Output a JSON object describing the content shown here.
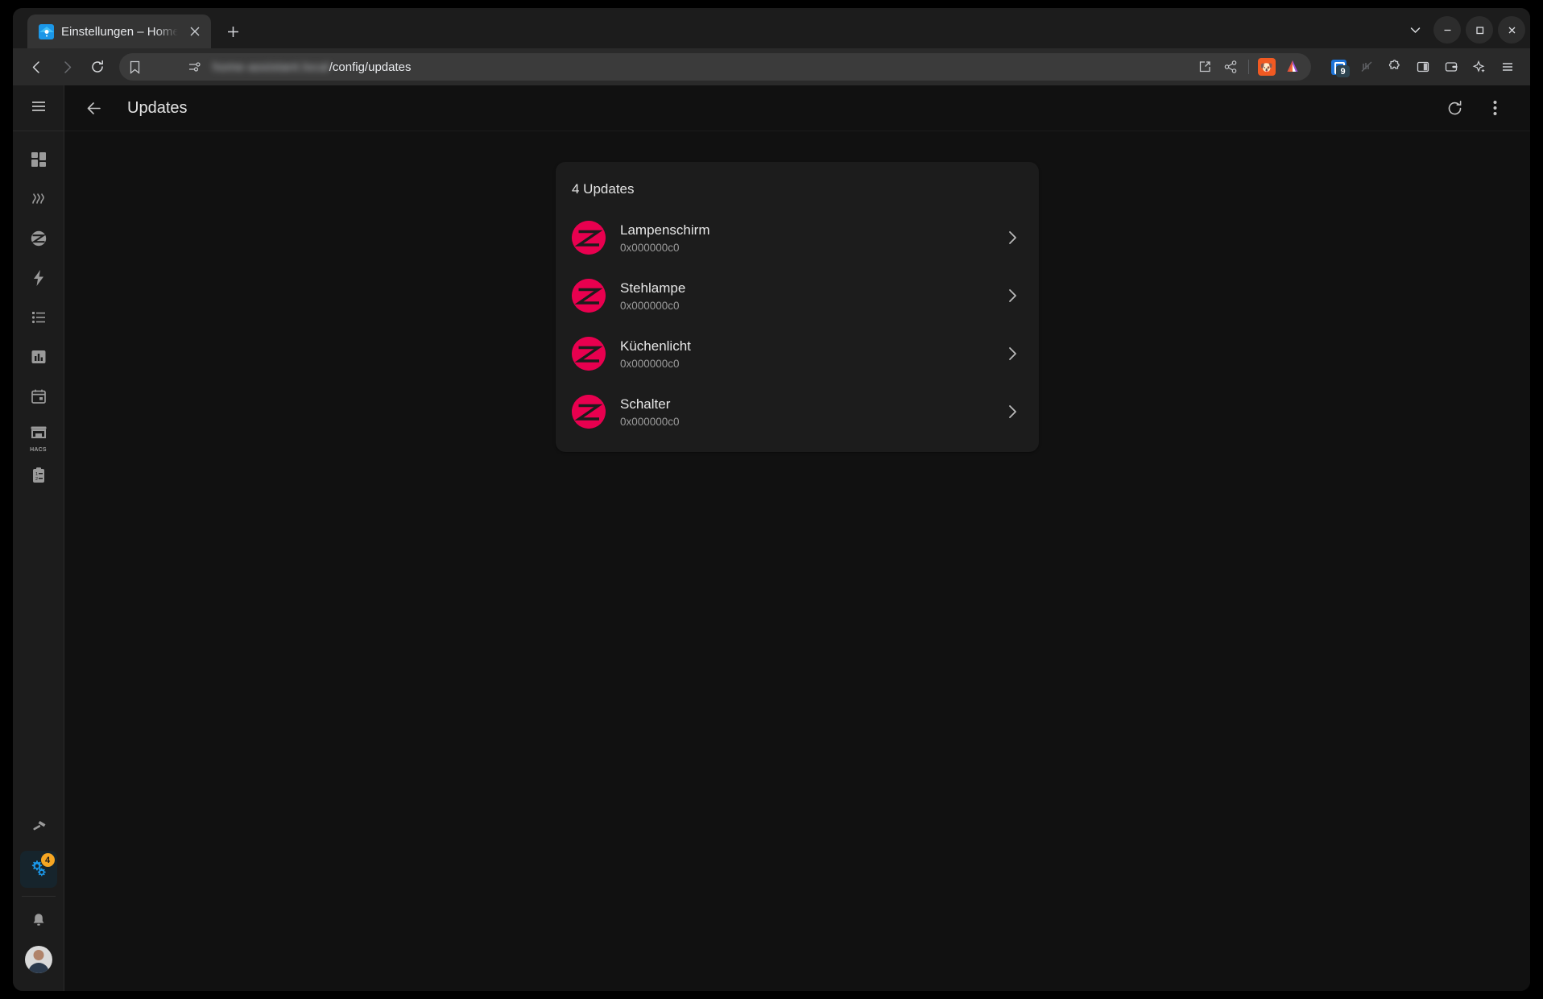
{
  "browser": {
    "tab": {
      "title": "Einstellungen – Home Assistant",
      "favicon_name": "home-assistant-favicon",
      "close_label": "×"
    },
    "newtab_label": "+",
    "window_controls": {
      "tab_search": "⌄",
      "minimize": "–",
      "maximize": "□",
      "close": "×"
    },
    "nav": {
      "back": "back-button",
      "forward": "forward-button",
      "reload": "reload-button"
    },
    "url": {
      "host_redacted": "home-assistant.local",
      "path": "/config/updates",
      "bookmark_label": "bookmark"
    },
    "toolbar_right": {
      "extension_badge": "9",
      "items": [
        "open-in-new-icon",
        "share-icon",
        "brave-shields-icon",
        "brave-rewards-icon",
        "extension-badged-icon",
        "extension-muted-icon",
        "extensions-puzzle-icon",
        "sidebar-panel-icon",
        "wallet-icon",
        "leo-ai-icon",
        "browser-menu-icon"
      ]
    }
  },
  "sidebar": {
    "menu_label": "menu",
    "items": [
      {
        "label": "Dashboard",
        "icon": "dashboard-grid-icon"
      },
      {
        "label": "Heizung",
        "icon": "heat-waves-icon"
      },
      {
        "label": "Zigbee",
        "icon": "zigbee-icon"
      },
      {
        "label": "Energie",
        "icon": "lightning-bolt-icon"
      },
      {
        "label": "Logbuch",
        "icon": "list-icon"
      },
      {
        "label": "Verlauf",
        "icon": "bar-chart-icon"
      },
      {
        "label": "Kalender",
        "icon": "calendar-icon"
      },
      {
        "label": "HACS",
        "icon": "hacs-store-icon"
      },
      {
        "label": "To-do-Listen",
        "icon": "clipboard-list-icon"
      }
    ],
    "hacs_label": "HACS",
    "bottom": [
      {
        "label": "Entwicklerwerkzeuge",
        "icon": "hammer-icon"
      },
      {
        "label": "Einstellungen",
        "icon": "settings-gears-icon",
        "badge": "4",
        "active": true
      }
    ],
    "notifications": {
      "label": "Benachrichtigungen",
      "icon": "bell-icon"
    },
    "user": {
      "label": "Benutzer",
      "icon": "user-avatar"
    }
  },
  "header": {
    "back_label": "back-arrow",
    "title": "Updates",
    "refresh_label": "refresh-icon",
    "overflow_label": "overflow-menu-icon"
  },
  "updates_card": {
    "title": "4 Updates",
    "rows": [
      {
        "name": "Lampenschirm",
        "version": "0x000000c0",
        "icon": "zigbee-logo"
      },
      {
        "name": "Stehlampe",
        "version": "0x000000c0",
        "icon": "zigbee-logo"
      },
      {
        "name": "Küchenlicht",
        "version": "0x000000c0",
        "icon": "zigbee-logo"
      },
      {
        "name": "Schalter",
        "version": "0x000000c0",
        "icon": "zigbee-logo"
      }
    ]
  },
  "colors": {
    "zigbee_red": "#e8004f",
    "badge_orange": "#f5a623",
    "active_blue": "#1b97e8",
    "page_bg": "#111111",
    "card_bg": "#1c1c1c"
  }
}
